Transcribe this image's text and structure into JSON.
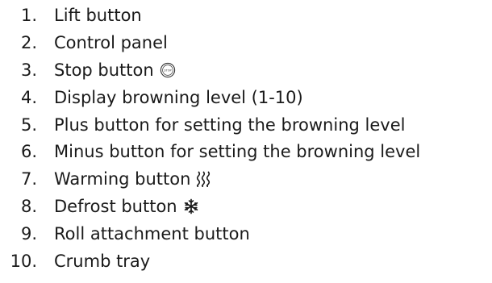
{
  "items": [
    {
      "number": "1.",
      "label": "Lift button"
    },
    {
      "number": "2.",
      "label": "Control panel"
    },
    {
      "number": "3.",
      "label": "Stop button",
      "icon": "stop-icon",
      "icon_text": "STOP"
    },
    {
      "number": "4.",
      "label": "Display browning level (1-10)"
    },
    {
      "number": "5.",
      "label": "Plus button for setting the browning level"
    },
    {
      "number": "6.",
      "label": "Minus button for setting the browning level"
    },
    {
      "number": "7.",
      "label": "Warming button",
      "icon": "warming-icon"
    },
    {
      "number": "8.",
      "label": "Defrost button",
      "icon": "snowflake-icon"
    },
    {
      "number": "9.",
      "label": "Roll attachment button"
    },
    {
      "number": "10.",
      "label": "Crumb tray"
    }
  ]
}
